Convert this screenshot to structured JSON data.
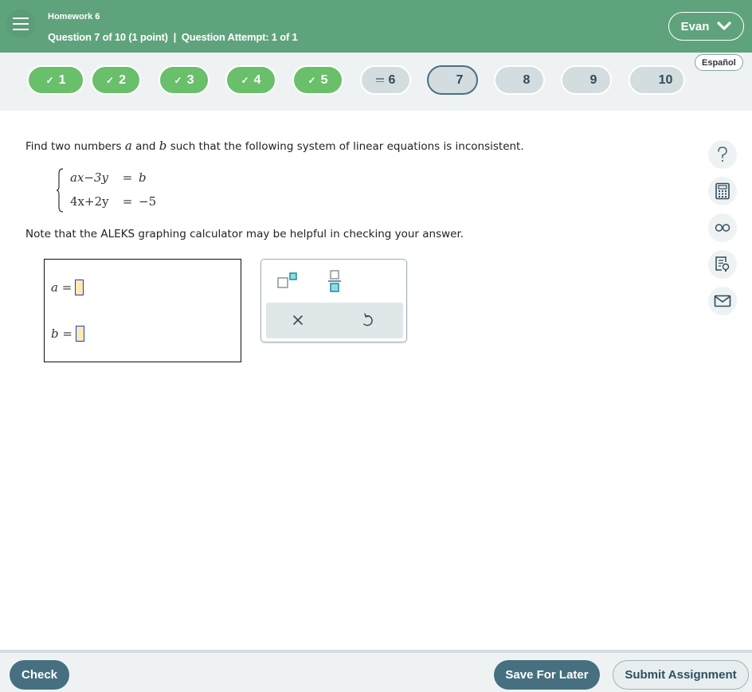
{
  "header": {
    "menu_icon": "hamburger-icon",
    "assignment_title": "Homework 6",
    "question_info": "Question 7 of 10 (1 point)  |  Question Attempt: 1 of 1",
    "user_name": "Evan",
    "user_chevron_icon": "chevron-down-icon",
    "language_label": "Español"
  },
  "question_nav": [
    {
      "label": "1",
      "status": "completed",
      "icon": "check-icon"
    },
    {
      "label": "2",
      "status": "completed",
      "icon": "check-icon"
    },
    {
      "label": "3",
      "status": "completed",
      "icon": "check-icon"
    },
    {
      "label": "4",
      "status": "completed",
      "icon": "check-icon"
    },
    {
      "label": "5",
      "status": "completed",
      "icon": "check-icon"
    },
    {
      "label": "6",
      "status": "partial",
      "icon": "lines-icon"
    },
    {
      "label": "7",
      "status": "current"
    },
    {
      "label": "8",
      "status": "unanswered"
    },
    {
      "label": "9",
      "status": "unanswered"
    },
    {
      "label": "10",
      "status": "unanswered"
    }
  ],
  "question": {
    "prompt_part1": "Find two numbers ",
    "var_a": "a",
    "prompt_part2": " and ",
    "var_b": "b",
    "prompt_part3": " such that the following system of linear equations is inconsistent.",
    "equations": [
      {
        "lhs": "ax−3y",
        "eq": "=",
        "rhs": "b"
      },
      {
        "lhs": "4x+2y",
        "eq": "=",
        "rhs": "−5"
      }
    ],
    "note": "Note that the ALEKS graphing calculator may be helpful in checking your answer."
  },
  "answers": [
    {
      "label": "a =",
      "value": ""
    },
    {
      "label": "b =",
      "value": ""
    }
  ],
  "palette": {
    "superscript_icon": "superscript-icon",
    "fraction_icon": "fraction-icon",
    "clear_icon": "close-icon",
    "undo_icon": "undo-icon"
  },
  "side_tools": [
    {
      "name": "help-icon"
    },
    {
      "name": "calculator-icon"
    },
    {
      "name": "glasses-icon"
    },
    {
      "name": "hint-icon"
    },
    {
      "name": "mail-icon"
    }
  ],
  "footer": {
    "check_label": "Check",
    "save_label": "Save For Later",
    "submit_label": "Submit Assignment"
  },
  "colors": {
    "header_bg": "#5fa37c",
    "completed": "#6abf6a",
    "primary_button": "#46707f",
    "input_fill": "#fdeab0",
    "input_border": "#1a3fd0"
  }
}
